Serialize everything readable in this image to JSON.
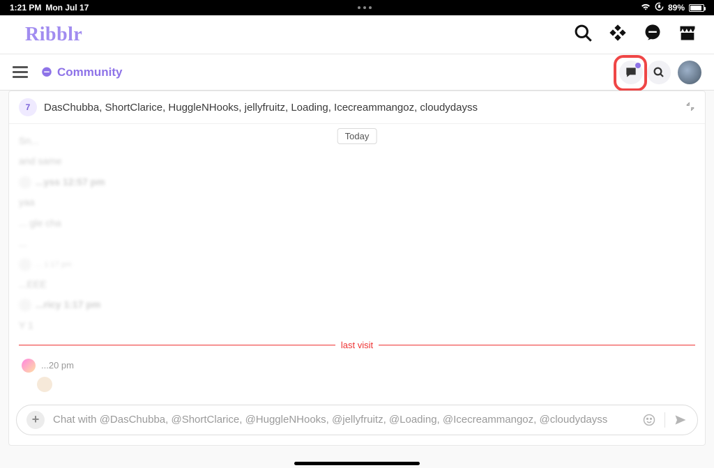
{
  "status": {
    "time": "1:21 PM",
    "date": "Mon Jul 17",
    "battery_pct": "89%",
    "battery_fill": 89
  },
  "brand": "Ribblr",
  "community": {
    "title": "Community"
  },
  "chat": {
    "avatar_count": "7",
    "participants": "DasChubba, ShortClarice, HuggleNHooks, jellyfruitz, Loading, Icecreammangoz, cloudydayss",
    "today_label": "Today",
    "last_visit": "last visit",
    "faded": [
      "Sn...",
      "and same",
      "...yss 12:57 pm",
      "yaa",
      "... gle cha",
      "...",
      "... 1:17 pm",
      "...EEE",
      "...ricy 1:17 pm",
      "Y  1"
    ],
    "recent_time": "...20 pm"
  },
  "composer": {
    "placeholder": "Chat with @DasChubba, @ShortClarice, @HuggleNHooks, @jellyfruitz, @Loading, @Icecreammangoz, @cloudydayss"
  }
}
